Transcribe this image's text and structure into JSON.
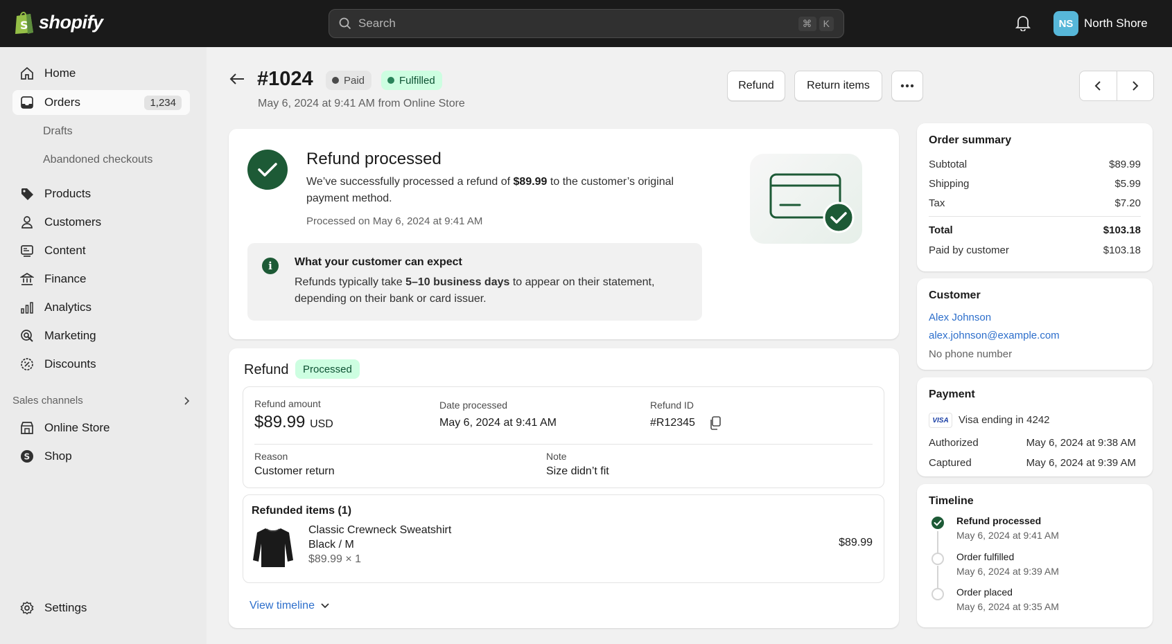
{
  "topbar": {
    "brand": "shopify",
    "search_placeholder": "Search",
    "shortcut_cmd": "⌘",
    "shortcut_key": "K",
    "avatar_initials": "NS",
    "store_name": "North Shore"
  },
  "sidebar": {
    "home": "Home",
    "orders": "Orders",
    "orders_count": "1,234",
    "drafts": "Drafts",
    "abandoned": "Abandoned checkouts",
    "products": "Products",
    "customers": "Customers",
    "content": "Content",
    "finance": "Finance",
    "analytics": "Analytics",
    "marketing": "Marketing",
    "discounts": "Discounts",
    "sales_channels": "Sales channels",
    "online_store": "Online Store",
    "shop": "Shop",
    "settings": "Settings"
  },
  "header": {
    "order_number": "#1024",
    "paid_badge": "Paid",
    "fulfilled_badge": "Fulfilled",
    "subline": "May 6, 2024 at 9:41 AM from Online Store",
    "refund_button": "Refund",
    "return_button": "Return items"
  },
  "processed": {
    "title": "Refund processed",
    "desc_prefix": "We’ve successfully processed a refund of ",
    "desc_amount": "$89.99",
    "desc_suffix": " to the customer’s original payment method.",
    "date": "Processed on May 6, 2024 at 9:41 AM",
    "expect_title": "What your customer can expect",
    "expect_prefix": "Refunds typically take ",
    "expect_bold": "5–10 business days",
    "expect_suffix": " to appear on their statement, depending on their bank or card issuer."
  },
  "refund": {
    "title": "Refund",
    "badge": "Processed",
    "amount_label": "Refund amount",
    "amount_value": "$89.99",
    "amount_currency": "USD",
    "date_label": "Date processed",
    "date_value": "May 6, 2024 at 9:41 AM",
    "id_label": "Refund ID",
    "id_value": "#R12345",
    "reason_label": "Reason",
    "reason_value": "Customer return",
    "note_label": "Note",
    "note_value": "Size didn’t fit",
    "items_title": "Refunded items (1)",
    "item_name": "Classic Crewneck Sweatshirt",
    "item_variant": "Black / M",
    "item_qty": "$89.99 × 1",
    "item_total": "$89.99",
    "view_timeline": "View timeline"
  },
  "summary": {
    "title": "Order summary",
    "rows": [
      {
        "label": "Subtotal",
        "value": "$89.99"
      },
      {
        "label": "Shipping",
        "value": "$5.99"
      },
      {
        "label": "Tax",
        "value": "$7.20"
      }
    ],
    "total_label": "Total",
    "total_value": "$103.18",
    "paid_label": "Paid by customer",
    "paid_value": "$103.18"
  },
  "customer": {
    "title": "Customer",
    "name": "Alex Johnson",
    "email": "alex.johnson@example.com",
    "phone": "No phone number"
  },
  "payment": {
    "title": "Payment",
    "card_brand": "VISA",
    "card_line": "Visa ending in 4242",
    "authorized_label": "Authorized",
    "authorized_value": "May 6, 2024 at 9:38 AM",
    "captured_label": "Captured",
    "captured_value": "May 6, 2024 at 9:39 AM"
  },
  "timeline": {
    "title": "Timeline",
    "events": [
      {
        "title": "Refund processed",
        "date": "May 6, 2024 at 9:41 AM"
      },
      {
        "title": "Order fulfilled",
        "date": "May 6, 2024 at 9:39 AM"
      },
      {
        "title": "Order placed",
        "date": "May 6, 2024 at 9:35 AM"
      }
    ]
  },
  "colors": {
    "accent_green": "#1d5a36",
    "link_blue": "#2c6ecb",
    "topbar": "#1a1a1a"
  }
}
